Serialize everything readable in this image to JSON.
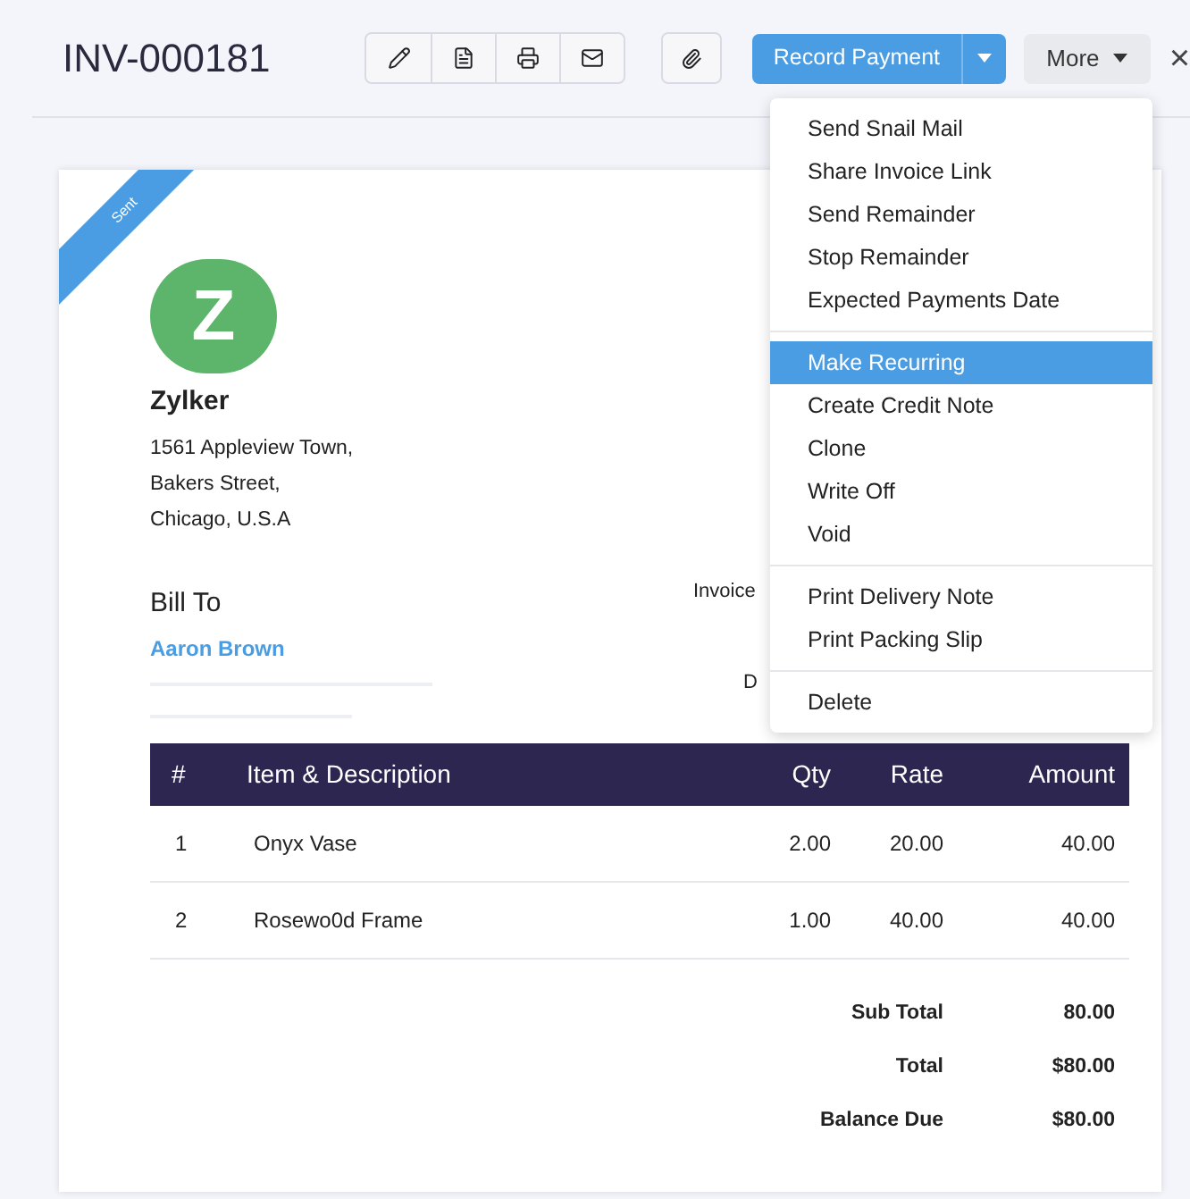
{
  "header": {
    "title": "INV-000181",
    "record_payment": "Record Payment",
    "more": "More",
    "close": "×"
  },
  "menu": {
    "sections": [
      {
        "items": [
          {
            "label": "Send Snail Mail",
            "selected": false
          },
          {
            "label": "Share Invoice Link",
            "selected": false
          },
          {
            "label": "Send Remainder",
            "selected": false
          },
          {
            "label": "Stop Remainder",
            "selected": false
          },
          {
            "label": "Expected Payments Date",
            "selected": false
          }
        ]
      },
      {
        "items": [
          {
            "label": "Make Recurring",
            "selected": true
          },
          {
            "label": "Create Credit Note",
            "selected": false
          },
          {
            "label": "Clone",
            "selected": false
          },
          {
            "label": "Write Off",
            "selected": false
          },
          {
            "label": "Void",
            "selected": false
          }
        ]
      },
      {
        "items": [
          {
            "label": "Print Delivery Note",
            "selected": false
          },
          {
            "label": "Print Packing Slip",
            "selected": false
          }
        ]
      },
      {
        "items": [
          {
            "label": "Delete",
            "selected": false
          }
        ]
      }
    ]
  },
  "invoice": {
    "status": "Sent",
    "logo_letter": "Z",
    "company": "Zylker",
    "address": [
      "1561 Appleview Town,",
      "Bakers Street,",
      "Chicago, U.S.A"
    ],
    "bill_to_label": "Bill To",
    "customer": "Aaron Brown",
    "invoice_label_partial": "Invoice",
    "date_label_partial": "D",
    "table": {
      "columns": [
        "#",
        "Item & Description",
        "Qty",
        "Rate",
        "Amount"
      ],
      "rows": [
        {
          "index": "1",
          "item": "Onyx Vase",
          "qty": "2.00",
          "rate": "20.00",
          "amount": "40.00"
        },
        {
          "index": "2",
          "item": "Rosewo0d Frame",
          "qty": "1.00",
          "rate": "40.00",
          "amount": "40.00"
        }
      ]
    },
    "totals": [
      {
        "label": "Sub Total",
        "value": "80.00"
      },
      {
        "label": "Total",
        "value": "$80.00"
      },
      {
        "label": "Balance Due",
        "value": "$80.00"
      }
    ]
  }
}
